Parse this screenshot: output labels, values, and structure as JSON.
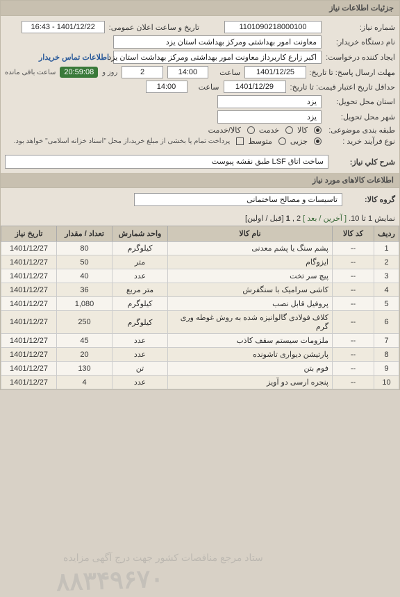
{
  "header": {
    "title": "جزئیات اطلاعات نیاز"
  },
  "info": {
    "need_no_label": "شماره نیاز:",
    "need_no": "1101090218000100",
    "announce_label": "تاریخ و ساعت اعلان عمومی:",
    "announce_value": "1401/12/22 - 16:43",
    "buyer_org_label": "نام دستگاه خریدار:",
    "buyer_org": "معاونت امور بهداشتی ومرکز بهداشت استان یزد",
    "requester_label": "ایجاد کننده درخواست:",
    "requester": "اکبر زارع کاربرداز معاونت امور بهداشتی ومرکز بهداشت استان یزد",
    "buyer_contact_label": "اطلاعات تماس خریدار",
    "deadline_label": "مهلت ارسال پاسخ: تا تاریخ:",
    "deadline_date": "1401/12/25",
    "time_label": "ساعت",
    "deadline_time": "14:00",
    "days_left_prefix": "",
    "days_left": "2",
    "days_left_unit_label": "روز و",
    "remaining_time": "20:59:08",
    "remaining_suffix": "ساعت باقی مانده",
    "validity_label": "حداقل تاریخ اعتبار قیمت: تا تاریخ:",
    "validity_date": "1401/12/29",
    "validity_time": "14:00",
    "province_req_label": "استان محل تحویل:",
    "province_req": "یزد",
    "city_req_label": "شهر محل تحویل:",
    "city_req": "یزد",
    "service_goods_label": "طبقه بندی موضوعی:",
    "svc_goods": "کالا",
    "svc_service": "خدمت",
    "svc_both": "کالا/خدمت",
    "purchase_type_label": "نوع فرآیند خرید :",
    "pt_small": "جزیی",
    "pt_med": "متوسط",
    "pt_pay_note": "پرداخت تمام یا بخشی از مبلغ خرید،از محل \"اسناد خزانه اسلامی\" خواهد بود."
  },
  "desc": {
    "label": "شرح کلي نياز:",
    "value": "ساخت اتاق LSF طبق نقشه پیوست"
  },
  "goods_section": {
    "title": "اطلاعات کالاهای مورد نیاز",
    "group_label": "گروه کالا:",
    "group_value": "تاسیسات و مصالح ساختمانی"
  },
  "pagination": {
    "text_prefix": "نمایش 1 تا 10.",
    "last": "[ آخرین",
    "next": "/ بعد ]",
    "total": "2 ,",
    "current": "1",
    "prev_first": "[قبل / اولین]"
  },
  "table": {
    "headers": {
      "row": "ردیف",
      "code": "کد کالا",
      "name": "نام کالا",
      "unit": "واحد شمارش",
      "qty": "تعداد / مقدار",
      "date": "تاریخ نیاز"
    },
    "rows": [
      {
        "n": "1",
        "code": "--",
        "name": "پشم سنگ یا پشم معدنی",
        "unit": "کیلوگرم",
        "qty": "80",
        "date": "1401/12/27"
      },
      {
        "n": "2",
        "code": "--",
        "name": "ایزوگام",
        "unit": "متر",
        "qty": "50",
        "date": "1401/12/27"
      },
      {
        "n": "3",
        "code": "--",
        "name": "پیچ سر تخت",
        "unit": "عدد",
        "qty": "40",
        "date": "1401/12/27"
      },
      {
        "n": "4",
        "code": "--",
        "name": "کاشی سرامیک با سنگفرش",
        "unit": "متر مربع",
        "qty": "36",
        "date": "1401/12/27"
      },
      {
        "n": "5",
        "code": "--",
        "name": "پروفیل قابل نصب",
        "unit": "کیلوگرم",
        "qty": "1,080",
        "date": "1401/12/27"
      },
      {
        "n": "6",
        "code": "--",
        "name": "کلاف فولادی گالوانیزه شده به روش غوطه وری گرم",
        "unit": "کیلوگرم",
        "qty": "250",
        "date": "1401/12/27"
      },
      {
        "n": "7",
        "code": "--",
        "name": "ملزومات سیستم سقف کاذب",
        "unit": "عدد",
        "qty": "45",
        "date": "1401/12/27"
      },
      {
        "n": "8",
        "code": "--",
        "name": "پارتیشن دیواری تاشونده",
        "unit": "عدد",
        "qty": "20",
        "date": "1401/12/27"
      },
      {
        "n": "9",
        "code": "--",
        "name": "فوم بتن",
        "unit": "تن",
        "qty": "130",
        "date": "1401/12/27"
      },
      {
        "n": "10",
        "code": "--",
        "name": "پنجره ارسی دو آویز",
        "unit": "عدد",
        "qty": "4",
        "date": "1401/12/27"
      }
    ]
  },
  "watermark": {
    "main": "۸۸۳۴۹۶۷۰",
    "sub": "ستاد مرجع مناقصات کشور  جهت درج آگهی مزایده"
  }
}
